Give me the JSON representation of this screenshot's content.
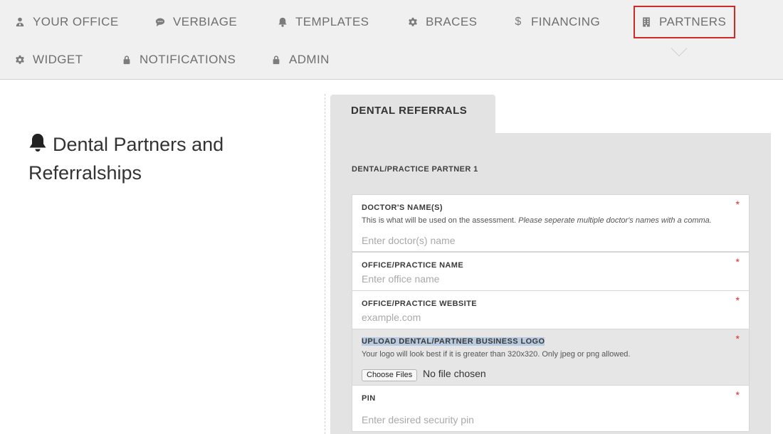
{
  "nav": {
    "items": [
      {
        "label": "YOUR OFFICE",
        "icon": "user-doctor-icon"
      },
      {
        "label": "VERBIAGE",
        "icon": "speech-bubble-icon"
      },
      {
        "label": "TEMPLATES",
        "icon": "bell-icon"
      },
      {
        "label": "BRACES",
        "icon": "gear-icon"
      },
      {
        "label": "FINANCING",
        "icon": "dollar-icon"
      },
      {
        "label": "PARTNERS",
        "icon": "building-icon",
        "active": true
      },
      {
        "label": "WIDGET",
        "icon": "gear-icon"
      },
      {
        "label": "NOTIFICATIONS",
        "icon": "lock-icon"
      },
      {
        "label": "ADMIN",
        "icon": "lock-icon"
      }
    ],
    "active_color": "#d3282a"
  },
  "page": {
    "title": "Dental Partners and Referralships",
    "title_icon": "bell-icon"
  },
  "tab": {
    "label": "DENTAL REFERRALS"
  },
  "form": {
    "section_label": "DENTAL/PRACTICE PARTNER 1",
    "required_mark": "*",
    "doctor": {
      "label": "DOCTOR'S NAME(S)",
      "desc": "This is what will be used on the assessment.",
      "desc_italic": "Please seperate multiple doctor's names with a comma.",
      "placeholder": "Enter doctor(s) name",
      "value": ""
    },
    "office_name": {
      "label": "OFFICE/PRACTICE NAME",
      "placeholder": "Enter office name",
      "value": ""
    },
    "website": {
      "label": "OFFICE/PRACTICE WEBSITE",
      "placeholder": "example.com",
      "value": ""
    },
    "logo": {
      "label": "UPLOAD DENTAL/PARTNER BUSINESS LOGO",
      "desc": "Your logo will look best if it is greater than 320x320. Only jpeg or png allowed.",
      "button_label": "Choose Files",
      "status": "No file chosen"
    },
    "pin": {
      "label": "PIN",
      "placeholder": "Enter desired security pin",
      "value": ""
    }
  }
}
